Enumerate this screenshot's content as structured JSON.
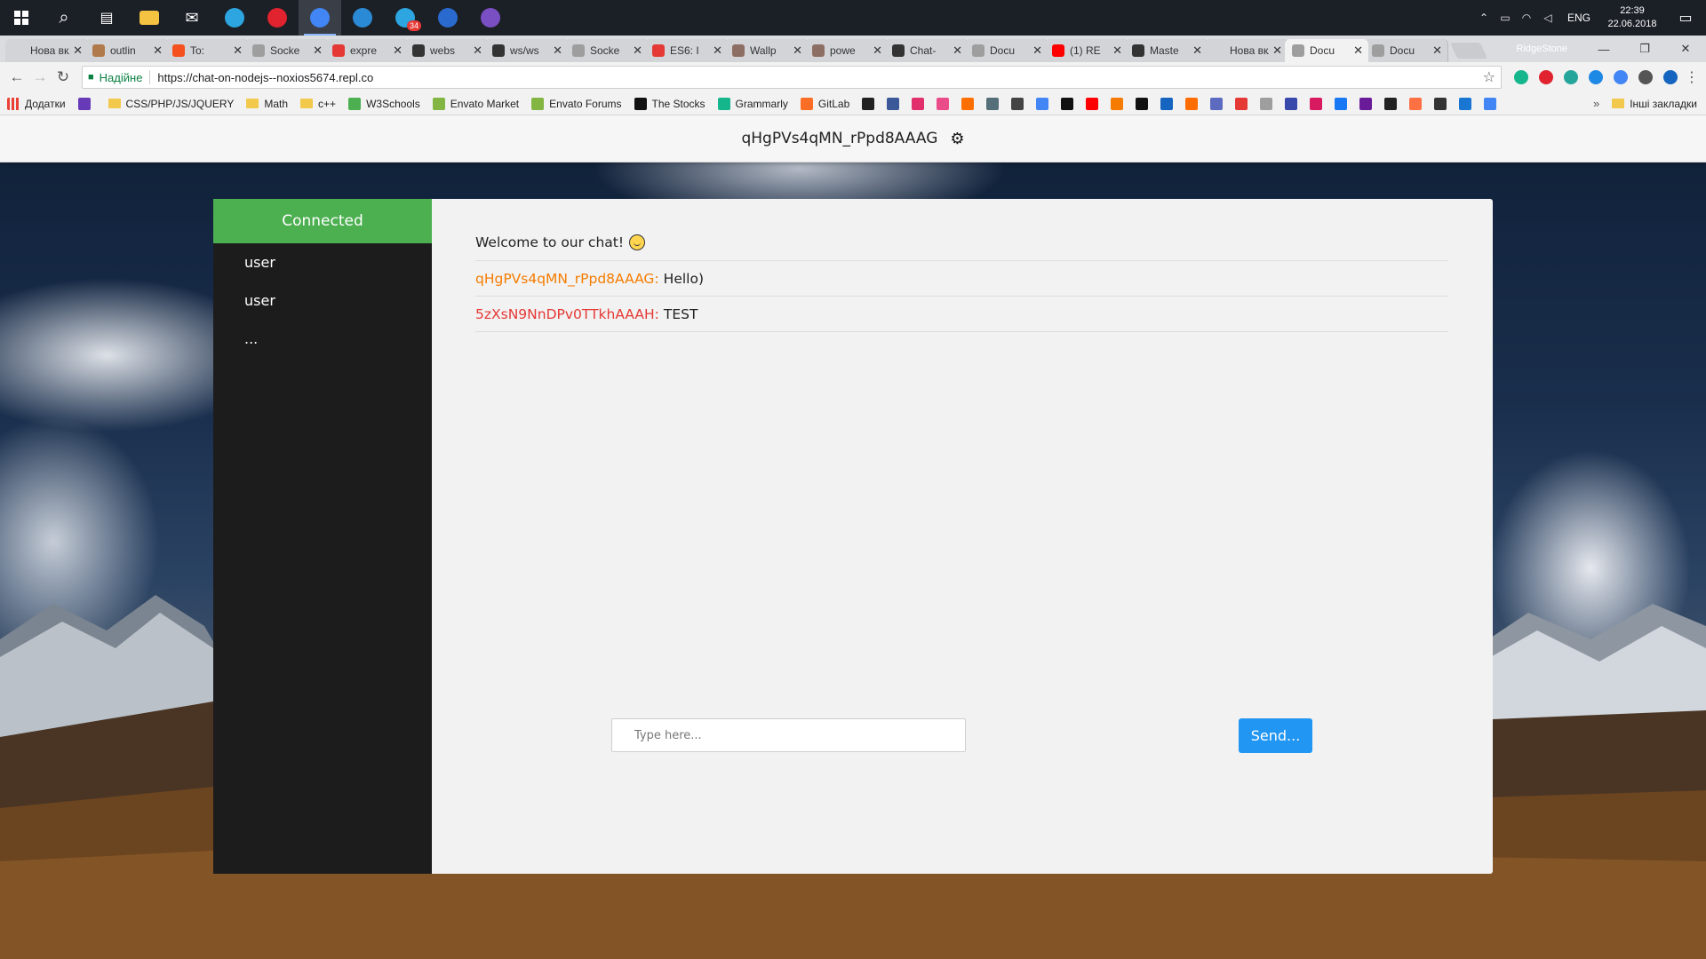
{
  "taskbar": {
    "apps": [
      {
        "name": "start",
        "color": "#ffffff"
      },
      {
        "name": "search",
        "color": "#ffffff"
      },
      {
        "name": "task-view",
        "color": "#ffffff"
      },
      {
        "name": "file-explorer",
        "color": "#f5c342"
      },
      {
        "name": "mail",
        "color": "#ffffff"
      },
      {
        "name": "telegram",
        "color": "#2ca5e0"
      },
      {
        "name": "opera",
        "color": "#e0232e"
      },
      {
        "name": "chrome",
        "color": "#4285f4",
        "active": true
      },
      {
        "name": "vscode",
        "color": "#2b8ad6"
      },
      {
        "name": "telegram-2",
        "color": "#2ca5e0",
        "badge": "34"
      },
      {
        "name": "powershell",
        "color": "#2a6acf"
      },
      {
        "name": "app-purple",
        "color": "#7b4fc4"
      }
    ],
    "language": "ENG",
    "time": "22:39",
    "date": "22.06.2018"
  },
  "browser": {
    "tabs": [
      {
        "title": "Нова вкла",
        "favicon": "#d2d4d7"
      },
      {
        "title": "outlin",
        "favicon": "#b07a4a"
      },
      {
        "title": "To:",
        "favicon": "#f4511e"
      },
      {
        "title": "Socke",
        "favicon": "#9e9e9e"
      },
      {
        "title": "expre",
        "favicon": "#e53935"
      },
      {
        "title": "webs",
        "favicon": "#333333"
      },
      {
        "title": "ws/ws",
        "favicon": "#333333"
      },
      {
        "title": "Socke",
        "favicon": "#9e9e9e"
      },
      {
        "title": "ES6: I",
        "favicon": "#e53935"
      },
      {
        "title": "Wallp",
        "favicon": "#8d6e63"
      },
      {
        "title": "powe",
        "favicon": "#8d6e63"
      },
      {
        "title": "Chat-",
        "favicon": "#333333"
      },
      {
        "title": "Docu",
        "favicon": "#9e9e9e"
      },
      {
        "title": "(1) RE",
        "favicon": "#ff0000"
      },
      {
        "title": "Maste",
        "favicon": "#333333"
      },
      {
        "title": "Нова вкла",
        "favicon": "#d2d4d7"
      },
      {
        "title": "Docu",
        "favicon": "#9e9e9e",
        "active": true
      },
      {
        "title": "Docu",
        "favicon": "#9e9e9e"
      }
    ],
    "profile": "RidgeStone",
    "security_label": "Надійне",
    "url": "https://chat-on-nodejs--noxios5674.repl.co",
    "extensions": [
      "#15b68c",
      "#e0232e",
      "#26a69a",
      "#1e88e5",
      "#4285f4",
      "#555555",
      "#1565c0"
    ],
    "bookmarks": [
      {
        "label": "Додатки",
        "icon": "#e94235",
        "type": "apps"
      },
      {
        "label": "",
        "icon": "#673ab7",
        "type": "icon"
      },
      {
        "label": "CSS/PHP/JS/JQUERY",
        "type": "folder"
      },
      {
        "label": "Math",
        "type": "folder"
      },
      {
        "label": "c++",
        "type": "folder"
      },
      {
        "label": "W3Schools",
        "icon": "#4caf50",
        "type": "icon"
      },
      {
        "label": "Envato Market",
        "icon": "#82b541",
        "type": "icon"
      },
      {
        "label": "Envato Forums",
        "icon": "#82b541",
        "type": "icon"
      },
      {
        "label": "The Stocks",
        "icon": "#111111",
        "type": "icon"
      },
      {
        "label": "Grammarly",
        "icon": "#15b68c",
        "type": "icon"
      },
      {
        "label": "GitLab",
        "icon": "#fc6d26",
        "type": "icon"
      }
    ],
    "bookmark_icons": [
      "#222222",
      "#3b5998",
      "#e1306c",
      "#ea4c89",
      "#ff6f00",
      "#546e7a",
      "#444444",
      "#4285f4",
      "#111111",
      "#ff0000",
      "#f57c00",
      "#111111",
      "#1565c0",
      "#ff6d00",
      "#5c6bc0",
      "#e53935",
      "#9e9e9e",
      "#3949ab",
      "#d81b60",
      "#1877f2",
      "#6a1b9a",
      "#222222",
      "#ff7043",
      "#333333",
      "#1976d2",
      "#4285f4"
    ],
    "other_bookmarks": "Інші закладки"
  },
  "chat": {
    "username": "qHgPVs4qMN_rPpd8AAAG",
    "status": "Connected",
    "status_color": "#4caf50",
    "users": [
      "user",
      "user",
      "..."
    ],
    "welcome": "Welcome to our chat!",
    "messages": [
      {
        "author": "qHgPVs4qMN_rPpd8AAAG:",
        "text": "Hello)",
        "color": "#f57c00"
      },
      {
        "author": "5zXsN9NnDPv0TTkhAAAH:",
        "text": "TEST",
        "color": "#e53935"
      }
    ],
    "input_placeholder": "Type here...",
    "send_label": "Send..."
  }
}
